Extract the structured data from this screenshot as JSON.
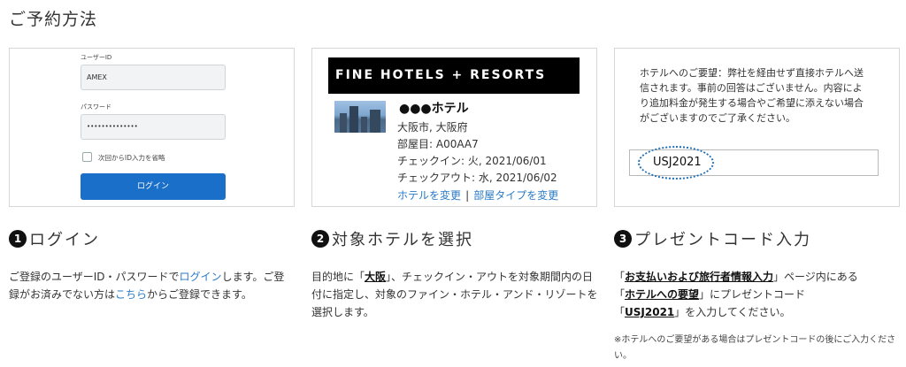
{
  "page": {
    "title": "ご予約方法"
  },
  "login_panel": {
    "user_id_label": "ユーザーID",
    "user_id_value": "AMEX",
    "password_label": "パスワード",
    "password_value": "••••••••••••••",
    "remember_label": "次回からID入力を省略",
    "login_button": "ログイン"
  },
  "hotel_panel": {
    "banner": "FINE HOTELS + RESORTS",
    "hotel_name": "●●●ホテル",
    "location": "大阪市, 大阪府",
    "room_type": "部屋目: A00AA7",
    "checkin": "チェックイン: 火, 2021/06/01",
    "checkout": "チェックアウト: 水, 2021/06/02",
    "change_hotel": "ホテルを変更",
    "separator": "|",
    "change_room": "部屋タイプを変更"
  },
  "request_panel": {
    "text": "ホテルへのご要望：弊社を経由せず直接ホテルへ送信されます。事前の回答はございません。内容により追加料金が発生する場合やご希望に添えない場合がございますのでご了承ください。",
    "code": "USJ2021"
  },
  "steps": [
    {
      "number": "1",
      "title": "ログイン",
      "desc_a": "ご登録のユーザーID・パスワードで",
      "link_a": "ログイン",
      "desc_b": "します。ご登録がお済みでない方は",
      "link_b": "こちら",
      "desc_c": "からご登録できます。"
    },
    {
      "number": "2",
      "title": "対象ホテルを選択",
      "desc_a": "目的地に「",
      "strong_a": "大阪",
      "desc_b": "」、チェックイン・アウトを対象期間内の日付に指定し、対象のファイン・ホテル・アンド・リゾートを選択します。"
    },
    {
      "number": "3",
      "title": "プレゼントコード入力",
      "q1_open": "「",
      "strong_a": "お支払いおよび旅行者情報入力",
      "q1_close": "」ページ内にある",
      "q2_open": "「",
      "strong_b": "ホテルへの要望",
      "q2_close": "」にプレゼントコード",
      "q3_open": "「",
      "strong_c": "USJ2021",
      "q3_close": "」を入力してください。",
      "note": "※ホテルへのご要望がある場合はプレゼントコードの後にご入力ください。"
    }
  ]
}
